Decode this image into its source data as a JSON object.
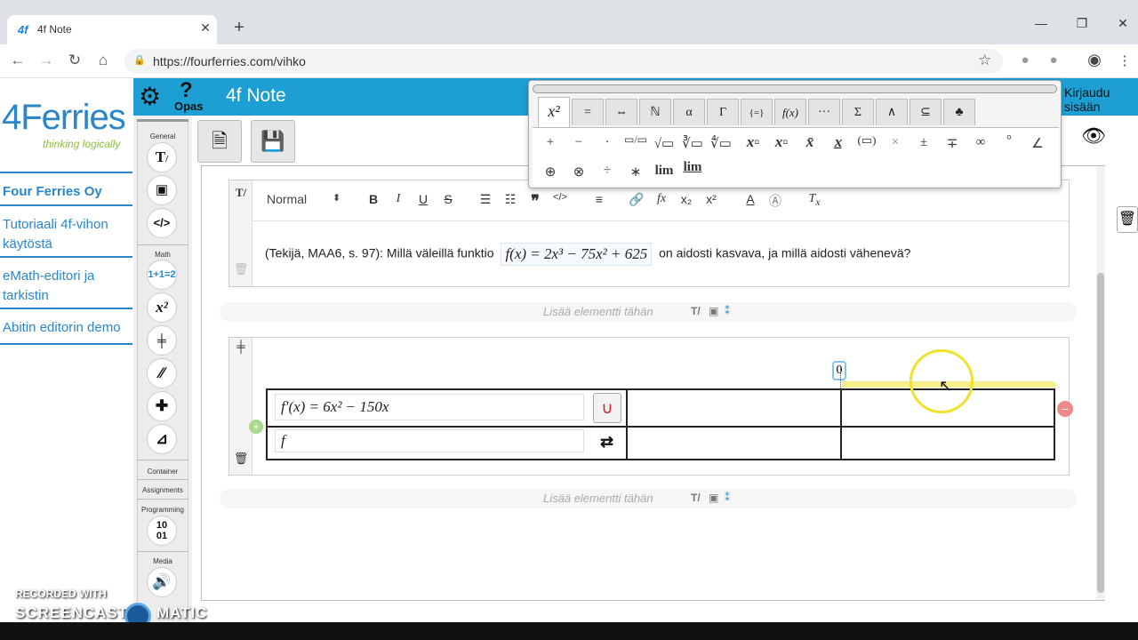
{
  "browser": {
    "tab_title": "4f Note",
    "tab_favicon": "4f",
    "url": "https://fourferries.com/vihko",
    "new_tab": "+",
    "minimize": "—",
    "maximize": "❐",
    "close": "✕"
  },
  "sidebar": {
    "logo_text": "4Ferries",
    "logo_tagline": "thinking logically",
    "links": [
      {
        "label": "Four Ferries Oy",
        "bold": true
      },
      {
        "label": "Tutoriaali 4f-vihon käytöstä"
      },
      {
        "label": "eMath-editori ja tarkistin"
      },
      {
        "label": "Abitin editorin demo"
      }
    ]
  },
  "header": {
    "help_label": "Opas",
    "title": "4f Note",
    "login": "Kirjaudu sisään"
  },
  "tools": {
    "general_label": "General",
    "math_label": "Math",
    "container_label": "Container",
    "assignments_label": "Assignments",
    "programming_label": "Programming",
    "media_label": "Media",
    "programming_icon": "10\n01"
  },
  "editor": {
    "style_select": "Normal",
    "text_before": "(Tekijä, MAA6, s. 97): Millä väleillä funktio",
    "formula": "f(x) = 2x³ − 75x² + 625",
    "text_after": "on aidosti kasvava, ja millä aidosti vähenevä?",
    "add_element": "Lisää elementti tähän"
  },
  "sign_chart": {
    "zero_marker": "0",
    "row1_expr": "f′(x) = 6x² − 150x",
    "row2_expr": "f"
  },
  "palette": {
    "tabs": [
      "x²",
      "=",
      "⇔",
      "ℕ",
      "α",
      "Γ",
      "{=}",
      "f(x)",
      "···",
      "Σ",
      "∧",
      "⊆",
      "♣"
    ],
    "row1": [
      "+",
      "−",
      "·",
      "▭/▭",
      "√▭",
      "∛▭",
      "∜▭",
      "x▫",
      "x▫",
      "x̄",
      "x̲",
      "(▭)",
      "×",
      "±",
      "∓",
      "∞",
      "°",
      "∠"
    ],
    "row2": [
      "⊕",
      "⊗",
      "÷",
      "∗",
      "lim",
      "lim"
    ]
  },
  "watermark": {
    "line1": "RECORDED WITH",
    "line2a": "SCREENCAST",
    "line2b": "MATIC"
  },
  "colors": {
    "brand_blue": "#2a86c9",
    "header_blue": "#1e9fd4",
    "highlight_yellow": "#eee22a"
  }
}
